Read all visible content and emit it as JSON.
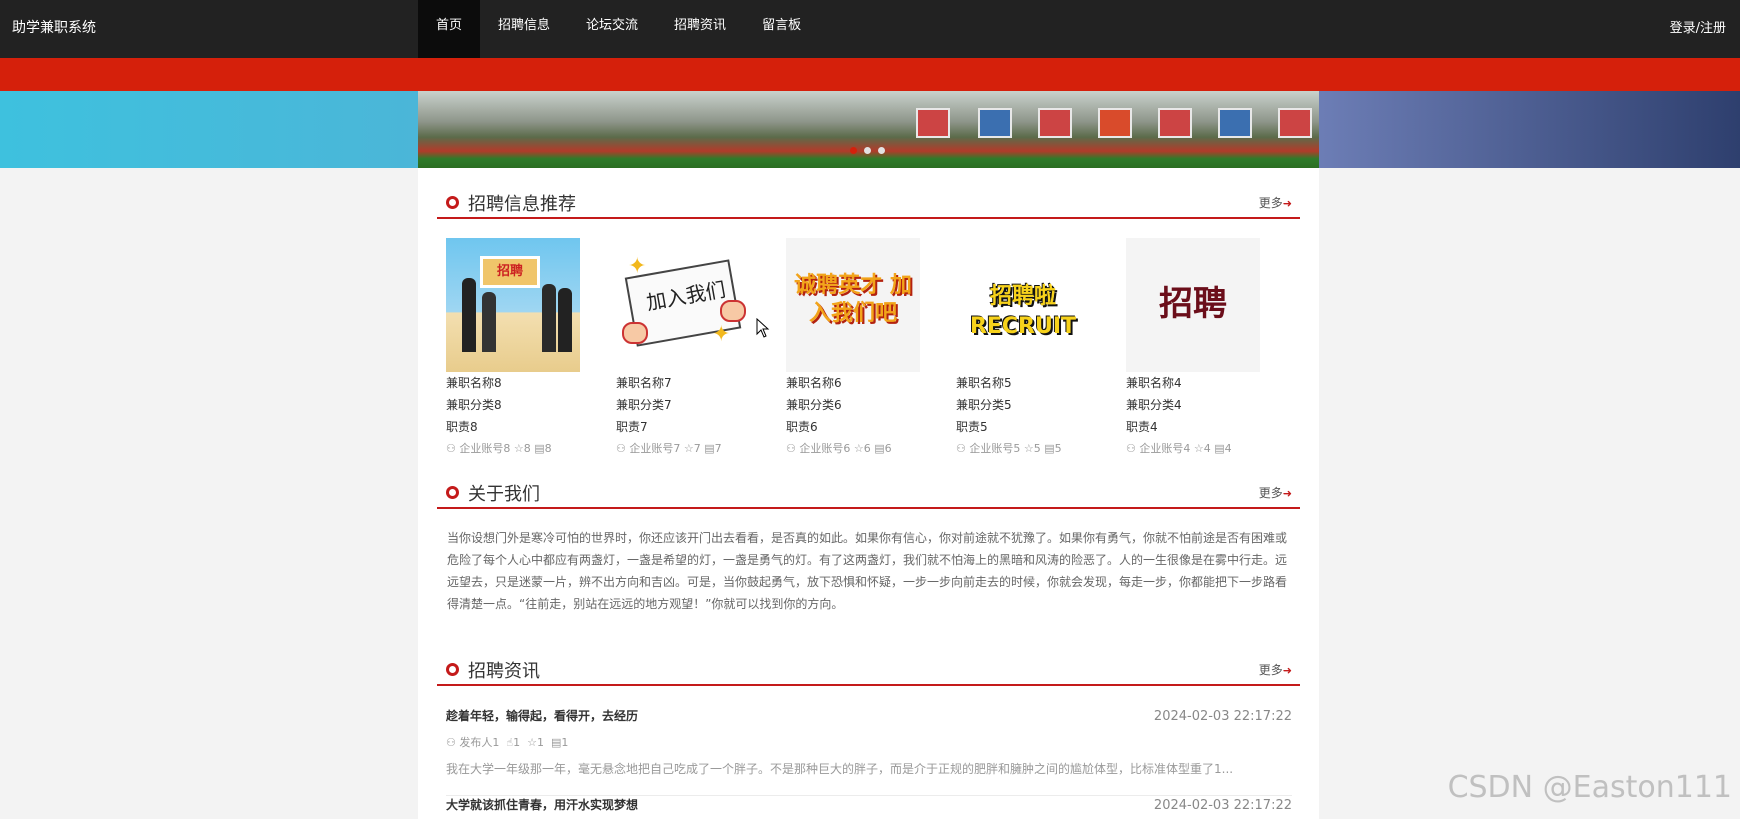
{
  "header": {
    "brand": "助学兼职系统",
    "nav": [
      "首页",
      "招聘信息",
      "论坛交流",
      "招聘资讯",
      "留言板"
    ],
    "login": "登录/注册"
  },
  "banner": {
    "slides": 3,
    "active_slide": 1
  },
  "recruit": {
    "title": "招聘信息推荐",
    "more": "更多",
    "cards": [
      {
        "image_text": "招聘",
        "name": "兼职名称8",
        "category": "兼职分类8",
        "duty": "职责8",
        "account": "企业账号8",
        "stars": "8",
        "comments": "8"
      },
      {
        "image_text": "加入我们",
        "name": "兼职名称7",
        "category": "兼职分类7",
        "duty": "职责7",
        "account": "企业账号7",
        "stars": "7",
        "comments": "7"
      },
      {
        "image_text": "诚聘英才 加入我们吧",
        "name": "兼职名称6",
        "category": "兼职分类6",
        "duty": "职责6",
        "account": "企业账号6",
        "stars": "6",
        "comments": "6"
      },
      {
        "image_text": "招聘啦 RECRUIT",
        "name": "兼职名称5",
        "category": "兼职分类5",
        "duty": "职责5",
        "account": "企业账号5",
        "stars": "5",
        "comments": "5"
      },
      {
        "image_text": "招聘",
        "name": "兼职名称4",
        "category": "兼职分类4",
        "duty": "职责4",
        "account": "企业账号4",
        "stars": "4",
        "comments": "4"
      }
    ]
  },
  "about": {
    "title": "关于我们",
    "more": "更多",
    "text": "当你设想门外是寒冷可怕的世界时，你还应该开门出去看看，是否真的如此。如果你有信心，你对前途就不犹豫了。如果你有勇气，你就不怕前途是否有困难或危险了每个人心中都应有两盏灯，一盏是希望的灯，一盏是勇气的灯。有了这两盏灯，我们就不怕海上的黑暗和风涛的险恶了。人的一生很像是在雾中行走。远远望去，只是迷蒙一片，辨不出方向和吉凶。可是，当你鼓起勇气，放下恐惧和怀疑，一步一步向前走去的时候，你就会发现，每走一步，你都能把下一步路看得清楚一点。“往前走，别站在远远的地方观望！”你就可以找到你的方向。"
  },
  "news": {
    "title": "招聘资讯",
    "more": "更多",
    "items": [
      {
        "title": "趁着年轻，输得起，看得开，去经历",
        "time": "2024-02-03 22:17:22",
        "author": "发布人1",
        "likes": "1",
        "stars": "1",
        "comments": "1",
        "summary": "我在大学一年级那一年，毫无悬念地把自己吃成了一个胖子。不是那种巨大的胖子，而是介于正规的肥胖和臃肿之间的尴尬体型，比标准体型重了1..."
      },
      {
        "title": "大学就该抓住青春，用汗水实现梦想",
        "time": "2024-02-03 22:17:22"
      }
    ]
  },
  "watermark": "CSDN @Easton111"
}
